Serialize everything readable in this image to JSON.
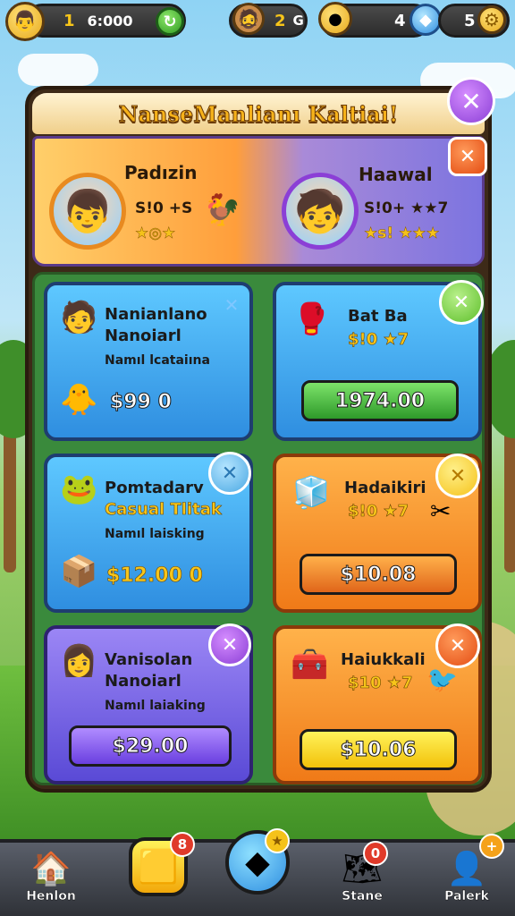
{
  "topbar": {
    "coins": "1",
    "coin_total": "6:000",
    "crowns": "2",
    "crown_suffix": "G",
    "gold": "4",
    "gems": "5"
  },
  "panel": {
    "title": "NanseManlianı Kaltiai!"
  },
  "versus": {
    "left": {
      "name": "Padızin",
      "stat": "S!0 +S",
      "stars": "★◎★"
    },
    "right": {
      "name": "Haawal",
      "stat": "S!0+ ★★7",
      "stars": "★s! ★★★"
    }
  },
  "cards": [
    {
      "title": "Nanianlano",
      "title2": "Nanoiarl",
      "desc": "Namıl lcataiına",
      "price": "$99 0",
      "color": "blue"
    },
    {
      "title": "Bat Ba",
      "sub": "$!0 ★7",
      "price": "1974.00",
      "color": "blue"
    },
    {
      "title": "Pomtadarv",
      "sub": "Casual Tlitak",
      "desc": "Namıl laisking",
      "price": "$12.00 0",
      "color": "blue"
    },
    {
      "title": "Hadaikiri",
      "sub": "$!0 ★7",
      "price": "$10.08",
      "color": "orange"
    },
    {
      "title": "Vanisolan",
      "title2": "Nanoiarl",
      "desc": "Namıl laiaking",
      "price": "$29.00",
      "color": "purple"
    },
    {
      "title": "Haiukkali",
      "sub": "$10 ★7",
      "price": "$10.06",
      "color": "orange"
    }
  ],
  "nav": {
    "home": "Henlon",
    "store": "Stane",
    "profile": "Palerk",
    "badge_left": "8",
    "badge_store": "0",
    "badge_profile": "+"
  }
}
